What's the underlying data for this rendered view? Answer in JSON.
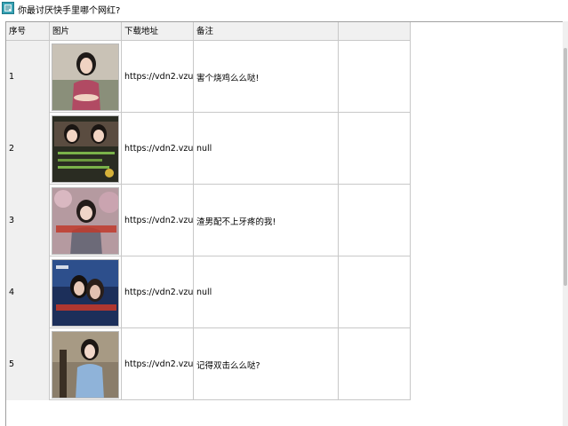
{
  "window": {
    "title": "你最讨厌快手里哪个网红?",
    "icon": "app-icon"
  },
  "table": {
    "headers": [
      "序号",
      "图片",
      "下载地址",
      "备注",
      ""
    ],
    "rows": [
      {
        "index": "1",
        "image": "photo-thumbnail",
        "url": "https://vdn2.vzu",
        "note": "害个烧鸡么么哒!"
      },
      {
        "index": "2",
        "image": "photo-thumbnail",
        "url": "https://vdn2.vzu",
        "note": "null"
      },
      {
        "index": "3",
        "image": "photo-thumbnail",
        "url": "https://vdn2.vzu",
        "note": "渣男配不上牙疼的我!"
      },
      {
        "index": "4",
        "image": "photo-thumbnail",
        "url": "https://vdn2.vzu",
        "note": "null"
      },
      {
        "index": "5",
        "image": "photo-thumbnail",
        "url": "https://vdn2.vzu",
        "note": "记得双击么么哒?"
      }
    ]
  },
  "colors": {
    "header_bg": "#f0f0f0",
    "grid_line": "#c8c8c8",
    "icon_teal": "#3aa3b5"
  }
}
